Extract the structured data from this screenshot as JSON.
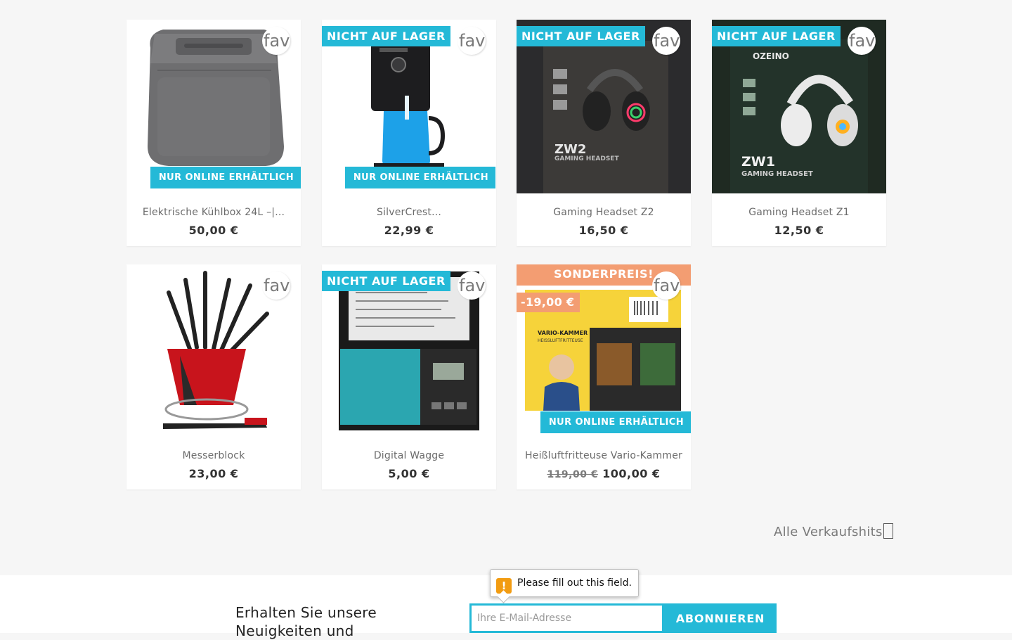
{
  "products": [
    {
      "name": "Elektrische Kühlbox 24L –|...",
      "price": "50,00 €",
      "fav": "favorite",
      "online": " NUR ONLINE ERHÄLTLICH",
      "image": "cooler-box"
    },
    {
      "name": "SilverCrest...",
      "price": "22,99 €",
      "fav": "favorite",
      "flag": "NICHT AUF LAGER",
      "online": " NUR ONLINE ERHÄLTLICH",
      "image": "coffee-machine"
    },
    {
      "name": "Gaming Headset Z2",
      "price": "16,50 €",
      "fav": "favorite",
      "flag": "NICHT AUF LAGER",
      "image": "headset-zw2",
      "box_text": "ZW2",
      "box_sub": "GAMING HEADSET"
    },
    {
      "name": "Gaming Headset Z1",
      "price": "12,50 €",
      "fav": "favorite",
      "flag": "NICHT AUF LAGER",
      "image": "headset-zw1",
      "box_text": "ZW1",
      "box_sub": "GAMING HEADSET",
      "brand": "OZEINO"
    },
    {
      "name": "Messerblock",
      "price": "23,00 €",
      "fav": "favorite",
      "image": "knife-block"
    },
    {
      "name": "Digital Wagge",
      "price": "5,00 €",
      "fav": "favorite",
      "flag": "NICHT AUF LAGER",
      "image": "digital-scale"
    },
    {
      "name": "Heißluftfritteuse Vario-Kammer",
      "old_price": "119,00 €",
      "price": "100,00 €",
      "fav": "favorite",
      "special": "SONDERPREIS!",
      "discount": "-19,00 €",
      "online": " NUR ONLINE ERHÄLTLICH",
      "image": "air-fryer",
      "box_text": "VARIO-KAMMER",
      "box_sub": "HEISSLUFTFRITTEUSE"
    }
  ],
  "all_sales_link": "Alle Verkaufshits",
  "newsletter": {
    "text": "Erhalten Sie unsere Neuigkeiten und",
    "email_placeholder": "Ihre E-Mail-Adresse",
    "subscribe_label": "ABONNIEREN",
    "tooltip": "Please fill out this field.",
    "tooltip_icon": "!"
  },
  "colors": {
    "accent": "#24b9d7",
    "special": "#f39d72",
    "background": "#f6f6f6"
  }
}
